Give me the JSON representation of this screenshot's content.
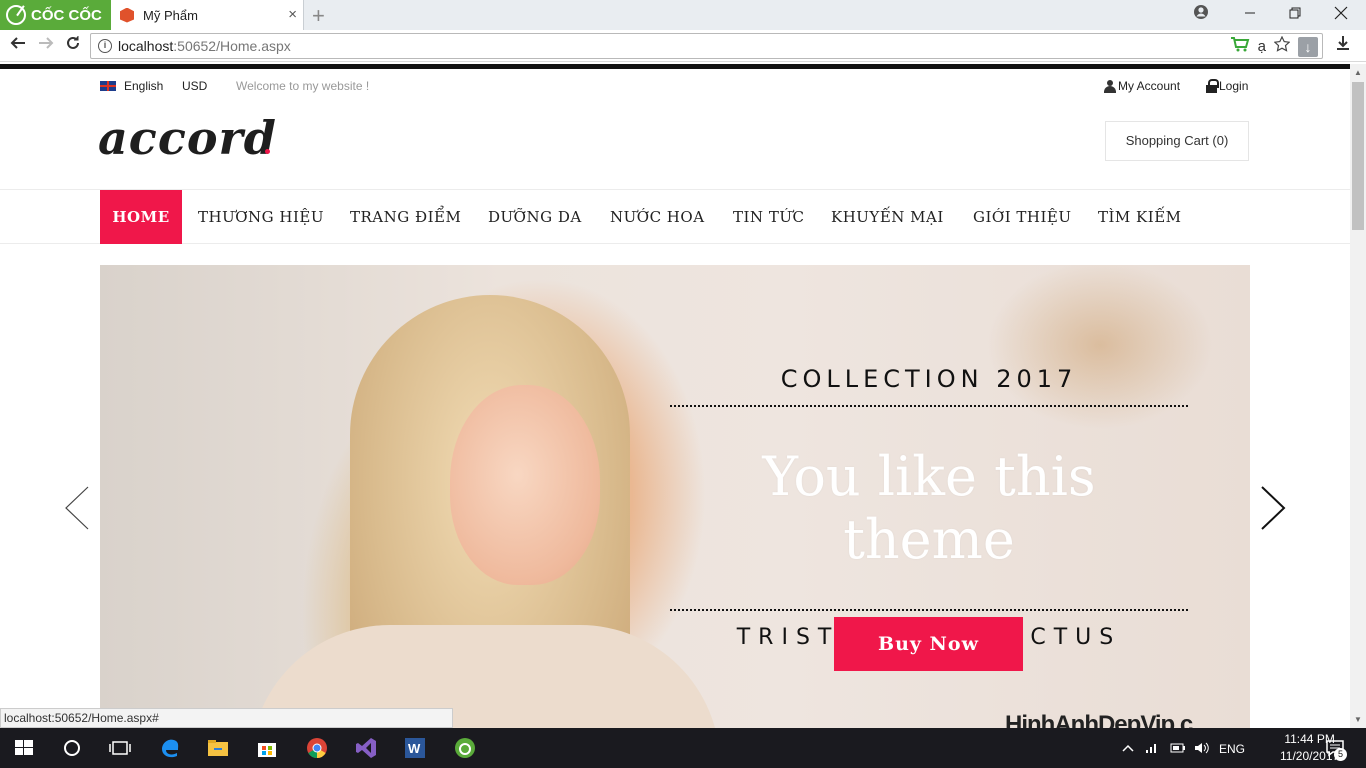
{
  "browser": {
    "brand": "CỐC CỐC",
    "tab_title": "Mỹ Phẩm",
    "tab_close": "×",
    "new_tab": "+",
    "url_host": "localhost",
    "url_rest": ":50652/Home.aspx",
    "status_url": "localhost:50652/Home.aspx#",
    "translit": "ạ"
  },
  "topbar": {
    "language": "English",
    "currency": "USD",
    "welcome": "Welcome to my website !",
    "my_account": "My Account",
    "login": "Login"
  },
  "header": {
    "logo": "accord",
    "cart": "Shopping Cart (0)"
  },
  "nav": {
    "items": [
      {
        "label": "HOME"
      },
      {
        "label": "THƯƠNG HIỆU"
      },
      {
        "label": "TRANG ĐIỂM"
      },
      {
        "label": "DƯỠNG DA"
      },
      {
        "label": "NƯỚC HOA"
      },
      {
        "label": "TIN TỨC"
      },
      {
        "label": "KHUYẾN MẠI"
      },
      {
        "label": "GIỚI THIỆU"
      },
      {
        "label": "TÌM KIẾM"
      }
    ]
  },
  "slider": {
    "heading": "COLLECTION 2017",
    "tagline": "You like this theme",
    "subheading": "TRISTIQUE SENECTUS",
    "button": "Buy Now"
  },
  "watermark": "HinhAnhDepVip.c",
  "taskbar": {
    "lang": "ENG",
    "time": "11:44 PM",
    "date": "11/20/2017",
    "notifications": "5"
  },
  "colors": {
    "accent": "#f0174a",
    "coccoc_green": "#5aab3a",
    "taskbar": "#1a1a1f"
  }
}
